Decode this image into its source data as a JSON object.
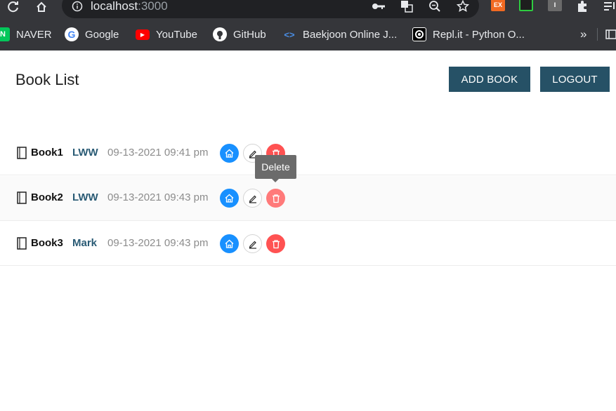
{
  "browser": {
    "url_host": "localhost",
    "url_port": ":3000",
    "extensions": {
      "ext1": "EX",
      "ext3": "I"
    },
    "bookmarks": [
      {
        "label": "NAVER",
        "icon": "naver-icon",
        "color": "#03c75a",
        "glyph": "N"
      },
      {
        "label": "Google",
        "icon": "google-icon",
        "color": "#ffffff",
        "glyph": "G"
      },
      {
        "label": "YouTube",
        "icon": "youtube-icon",
        "color": "#ff0000",
        "glyph": "▶"
      },
      {
        "label": "GitHub",
        "icon": "github-icon",
        "color": "#ffffff",
        "glyph": ""
      },
      {
        "label": "Baekjoon Online J...",
        "icon": "code-icon",
        "color": "#4a8fe7",
        "glyph": "<>"
      },
      {
        "label": "Repl.it - Python O...",
        "icon": "replit-icon",
        "color": "#000000",
        "glyph": ""
      }
    ],
    "overflow_label": "»"
  },
  "page": {
    "title": "Book List",
    "add_button": "ADD BOOK",
    "logout_button": "LOGOUT"
  },
  "books": [
    {
      "title": "Book1",
      "author": "LWW",
      "date": "09-13-2021 09:41 pm"
    },
    {
      "title": "Book2",
      "author": "LWW",
      "date": "09-13-2021 09:43 pm"
    },
    {
      "title": "Book3",
      "author": "Mark",
      "date": "09-13-2021 09:43 pm"
    }
  ],
  "tooltip": {
    "text": "Delete"
  },
  "colors": {
    "primary_button": "#265166",
    "home_action": "#1890ff",
    "delete_action": "#ff5252",
    "author_text": "#2a5b75"
  }
}
